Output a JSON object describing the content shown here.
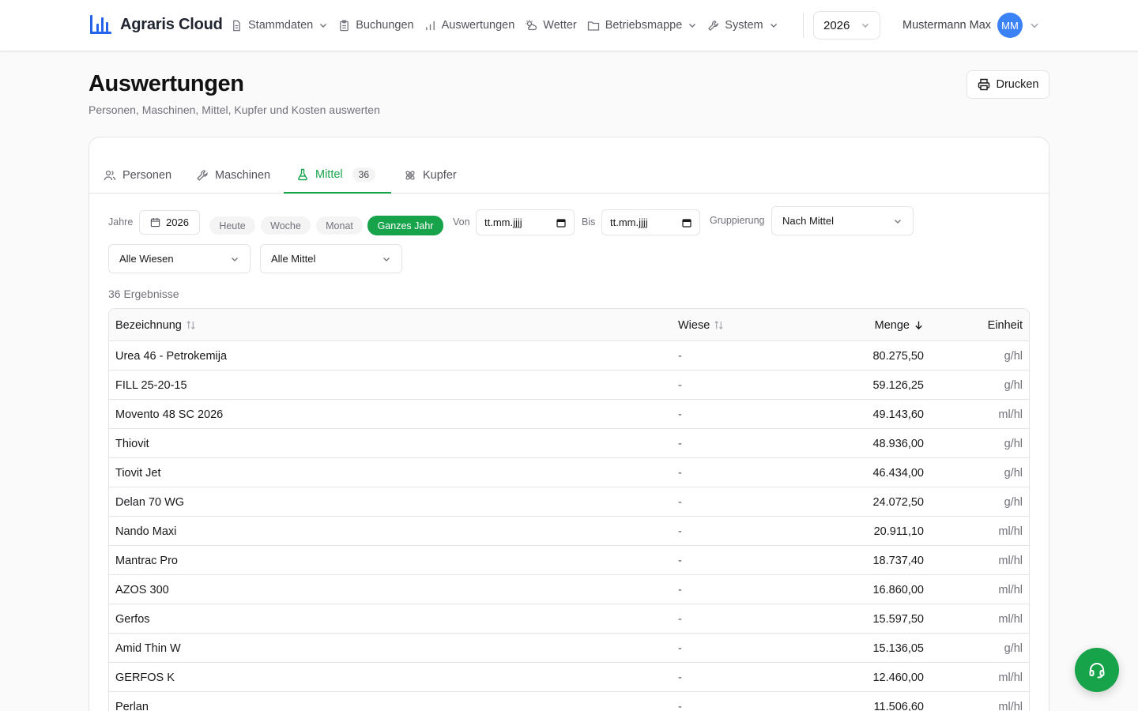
{
  "brand": {
    "name": "Agraris Cloud"
  },
  "nav": {
    "items": [
      {
        "label": "Stammdaten",
        "icon": "document-icon",
        "has_dropdown": true
      },
      {
        "label": "Buchungen",
        "icon": "clipboard-icon",
        "has_dropdown": false
      },
      {
        "label": "Auswertungen",
        "icon": "bar-chart-icon",
        "has_dropdown": false
      },
      {
        "label": "Wetter",
        "icon": "weather-icon",
        "has_dropdown": false
      },
      {
        "label": "Betriebsmappe",
        "icon": "folder-icon",
        "has_dropdown": true
      },
      {
        "label": "System",
        "icon": "wrench-icon",
        "has_dropdown": true
      }
    ]
  },
  "year_select": {
    "value": "2026"
  },
  "user": {
    "name": "Mustermann Max",
    "initials": "MM"
  },
  "page": {
    "title": "Auswertungen",
    "subtitle": "Personen, Maschinen, Mittel, Kupfer und Kosten auswerten",
    "print_label": "Drucken"
  },
  "tabs": [
    {
      "label": "Personen",
      "icon": "users-icon",
      "active": false
    },
    {
      "label": "Maschinen",
      "icon": "wrench-icon",
      "active": false
    },
    {
      "label": "Mittel",
      "icon": "flask-icon",
      "active": true,
      "badge": "36"
    },
    {
      "label": "Kupfer",
      "icon": "atom-icon",
      "active": false
    }
  ],
  "filters": {
    "jahre_label": "Jahre",
    "jahre_value": "2026",
    "quick": [
      {
        "label": "Heute",
        "active": false
      },
      {
        "label": "Woche",
        "active": false
      },
      {
        "label": "Monat",
        "active": false
      },
      {
        "label": "Ganzes Jahr",
        "active": true
      }
    ],
    "von_label": "Von",
    "von_placeholder": "tt.mm.jjjj",
    "bis_label": "Bis",
    "bis_placeholder": "tt.mm.jjjj",
    "gruppierung_label": "Gruppierung",
    "gruppierung_value": "Nach Mittel",
    "wiesen_value": "Alle Wiesen",
    "mittel_value": "Alle Mittel"
  },
  "result_count": "36 Ergebnisse",
  "table": {
    "headers": {
      "name": "Bezeichnung",
      "wiese": "Wiese",
      "menge": "Menge",
      "einheit": "Einheit"
    },
    "rows": [
      {
        "name": "Urea 46 - Petrokemija",
        "wiese": "-",
        "menge": "80.275,50",
        "einheit": "g/hl"
      },
      {
        "name": "FILL 25-20-15",
        "wiese": "-",
        "menge": "59.126,25",
        "einheit": "g/hl"
      },
      {
        "name": "Movento 48 SC 2026",
        "wiese": "-",
        "menge": "49.143,60",
        "einheit": "ml/hl"
      },
      {
        "name": "Thiovit",
        "wiese": "-",
        "menge": "48.936,00",
        "einheit": "g/hl"
      },
      {
        "name": "Tiovit Jet",
        "wiese": "-",
        "menge": "46.434,00",
        "einheit": "g/hl"
      },
      {
        "name": "Delan 70 WG",
        "wiese": "-",
        "menge": "24.072,50",
        "einheit": "g/hl"
      },
      {
        "name": "Nando Maxi",
        "wiese": "-",
        "menge": "20.911,10",
        "einheit": "ml/hl"
      },
      {
        "name": "Mantrac Pro",
        "wiese": "-",
        "menge": "18.737,40",
        "einheit": "ml/hl"
      },
      {
        "name": "AZOS 300",
        "wiese": "-",
        "menge": "16.860,00",
        "einheit": "ml/hl"
      },
      {
        "name": "Gerfos",
        "wiese": "-",
        "menge": "15.597,50",
        "einheit": "ml/hl"
      },
      {
        "name": "Amid Thin W",
        "wiese": "-",
        "menge": "15.136,05",
        "einheit": "g/hl"
      },
      {
        "name": "GERFOS K",
        "wiese": "-",
        "menge": "12.460,00",
        "einheit": "ml/hl"
      },
      {
        "name": "Perlan",
        "wiese": "-",
        "menge": "11.506,60",
        "einheit": "ml/hl"
      }
    ]
  },
  "colors": {
    "accent": "#16a34a",
    "avatar": "#3b82f6",
    "brand_icon": "#2563eb"
  }
}
